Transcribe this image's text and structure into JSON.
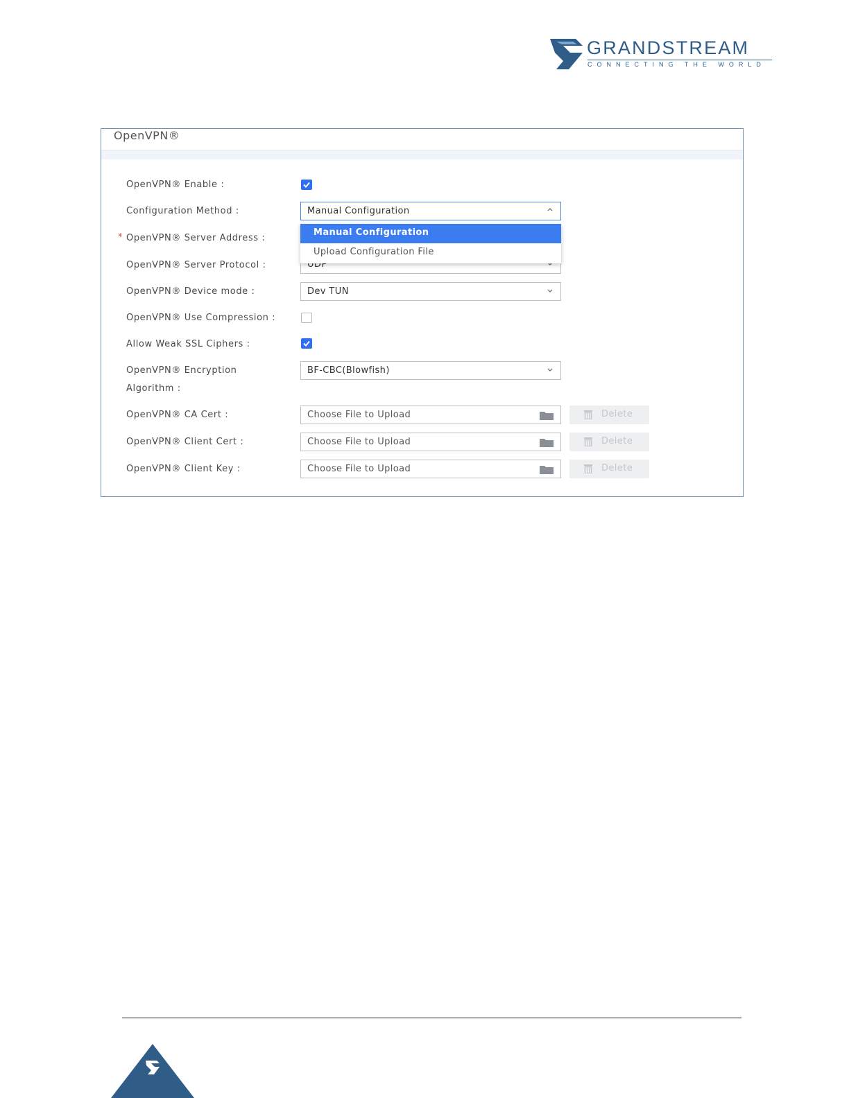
{
  "brand": {
    "name": "GRANDSTREAM",
    "tagline": "CONNECTING THE WORLD",
    "color": "#2f5d88"
  },
  "panel": {
    "title": "OpenVPN®"
  },
  "form": {
    "enable_label": "OpenVPN® Enable :",
    "enable_checked": true,
    "config_method_label": "Configuration Method :",
    "config_method_value": "Manual Configuration",
    "config_method_options": [
      "Manual Configuration",
      "Upload Configuration File"
    ],
    "server_address_label": "OpenVPN® Server Address :",
    "server_address_required": "*",
    "server_protocol_label": "OpenVPN® Server Protocol :",
    "server_protocol_value": "UDP",
    "device_mode_label": "OpenVPN® Device mode :",
    "device_mode_value": "Dev TUN",
    "compression_label": "OpenVPN® Use Compression :",
    "compression_checked": false,
    "weak_ssl_label": "Allow Weak SSL Ciphers :",
    "weak_ssl_checked": true,
    "encryption_label_line1": "OpenVPN® Encryption",
    "encryption_label_line2": "Algorithm :",
    "encryption_value": "BF-CBC(Blowfish)",
    "ca_cert_label": "OpenVPN® CA Cert :",
    "client_cert_label": "OpenVPN® Client Cert :",
    "client_key_label": "OpenVPN® Client Key :",
    "file_placeholder": "Choose File to Upload",
    "delete_label": "Delete"
  },
  "colors": {
    "accent": "#3c7cf1",
    "checkbox": "#2f6ff0",
    "required": "#e04a4a",
    "panel_border": "#6e8fb3"
  }
}
